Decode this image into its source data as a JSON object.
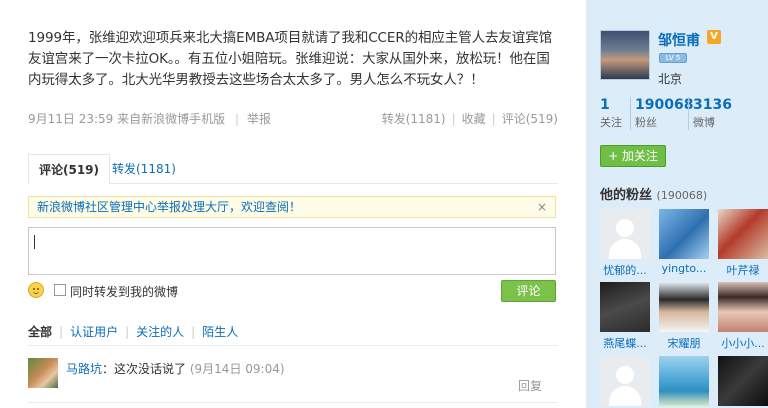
{
  "post": {
    "text": "1999年，张维迎欢迎项兵来北大搞EMBA项目就请了我和CCER的相应主管人去友谊宾馆友谊宫来了一次卡拉OK。。有五位小姐陪玩。张维迎说：大家从国外来，放松玩！他在国内玩得太多了。北大光华男教授去这些场合太太多了。男人怎么不玩女人？！",
    "timestamp": "9月11日 23:59",
    "source": "来自新浪微博手机版",
    "report": "举报",
    "repost": "转发(1181)",
    "favorite": "收藏",
    "comment": "评论(519)"
  },
  "tabs": {
    "comments": "评论(519)",
    "reposts": "转发(1181)"
  },
  "notice": {
    "text": "新浪微博社区管理中心举报处理大厅，欢迎查阅！",
    "close": "×"
  },
  "composer": {
    "placeholder": "",
    "repost_label": "同时转发到我的微博",
    "submit": "评论"
  },
  "filters": [
    "全部",
    "认证用户",
    "关注的人",
    "陌生人"
  ],
  "comments": [
    {
      "name": "马路坑",
      "text": "：这次没话说了",
      "time": "(9月14日 09:04)",
      "reply": "回复"
    }
  ],
  "profile": {
    "name": "邹恒甫",
    "verified_icon": "V",
    "level": "LV 5",
    "location": "北京",
    "stats": [
      {
        "num": "1",
        "label": "关注"
      },
      {
        "num": "190068",
        "label": "粉丝"
      },
      {
        "num": "3136",
        "label": "微博"
      }
    ],
    "follow_button": "+ 加关注"
  },
  "fans": {
    "title": "他的粉丝",
    "count": "(190068)",
    "items": [
      {
        "name": "忧郁的..."
      },
      {
        "name": "yingto..."
      },
      {
        "name": "叶芹禄"
      },
      {
        "name": "燕尾蝶..."
      },
      {
        "name": "宋耀朋"
      },
      {
        "name": "小小小..."
      },
      {
        "name": ""
      },
      {
        "name": ""
      },
      {
        "name": ""
      }
    ]
  },
  "colors": {
    "link": "#0a6eb9",
    "side_bg": "#dcecf9",
    "button_green": "#7cc24a"
  }
}
